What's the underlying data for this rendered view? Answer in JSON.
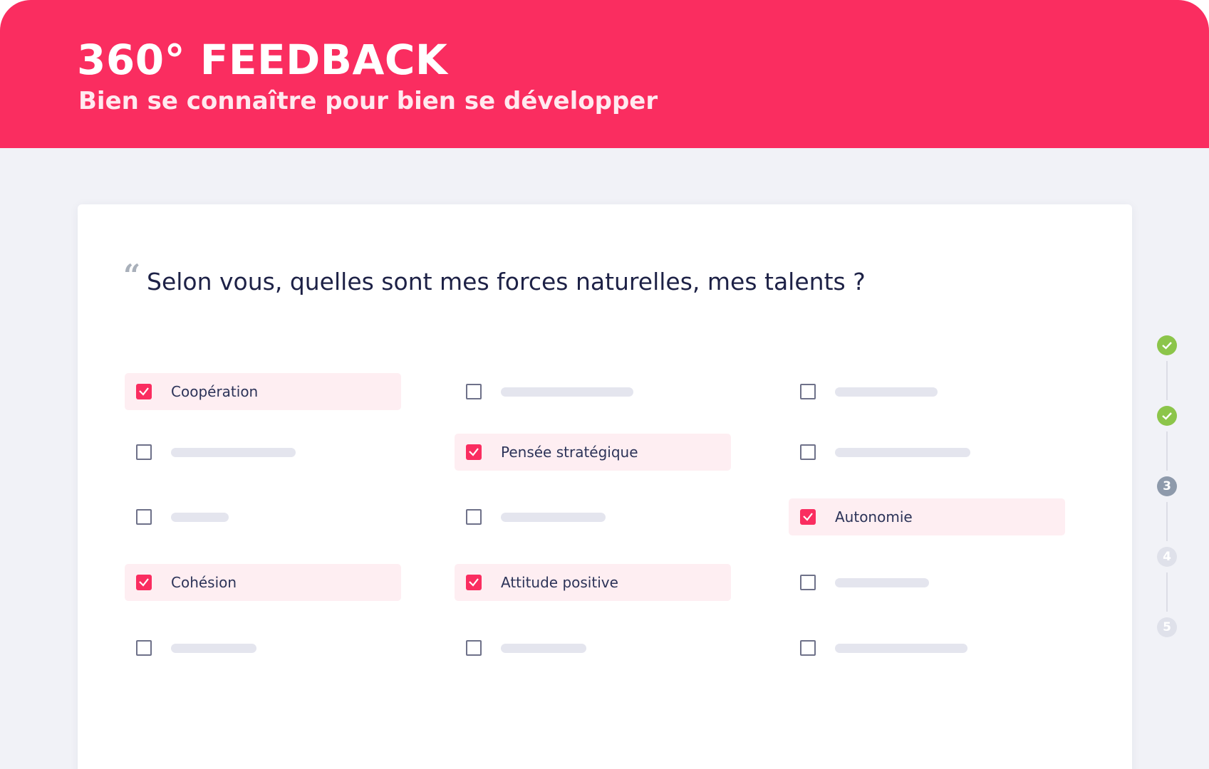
{
  "header": {
    "title": "360° FEEDBACK",
    "subtitle": "Bien se connaître pour bien se développer"
  },
  "question": {
    "icon": "quote-icon",
    "text": "Selon vous, quelles sont mes forces naturelles, mes talents ?"
  },
  "colors": {
    "brand": "#fa2d60",
    "done": "#8cc54a",
    "current": "#8e9aab",
    "pending": "#dfe1ea",
    "selected_bg": "#feeef2"
  },
  "options": [
    [
      {
        "checked": true,
        "label": "Coopération"
      },
      {
        "checked": false,
        "placeholder_pct": 48
      },
      {
        "checked": false,
        "placeholder_pct": 37
      }
    ],
    [
      {
        "checked": false,
        "placeholder_pct": 45
      },
      {
        "checked": true,
        "label": "Pensée stratégique"
      },
      {
        "checked": false,
        "placeholder_pct": 49
      }
    ],
    [
      {
        "checked": false,
        "placeholder_pct": 21
      },
      {
        "checked": false,
        "placeholder_pct": 38
      },
      {
        "checked": true,
        "label": "Autonomie"
      }
    ],
    [
      {
        "checked": true,
        "label": "Cohésion"
      },
      {
        "checked": true,
        "label": "Attitude positive"
      },
      {
        "checked": false,
        "placeholder_pct": 34
      }
    ],
    [
      {
        "checked": false,
        "placeholder_pct": 31
      },
      {
        "checked": false,
        "placeholder_pct": 31
      },
      {
        "checked": false,
        "placeholder_pct": 48
      }
    ]
  ],
  "steps": [
    {
      "state": "done",
      "label": ""
    },
    {
      "state": "done",
      "label": ""
    },
    {
      "state": "current",
      "label": "3"
    },
    {
      "state": "pending",
      "label": "4"
    },
    {
      "state": "pending",
      "label": "5"
    }
  ]
}
